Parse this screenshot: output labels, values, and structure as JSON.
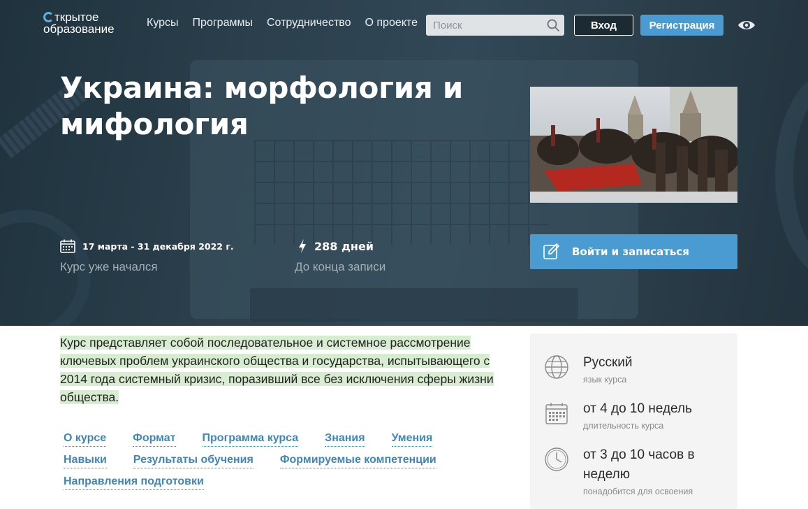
{
  "header": {
    "logo_line1": "ткрытое",
    "logo_line2": "образование",
    "nav": [
      "Курсы",
      "Программы",
      "Сотрудничество",
      "О проекте"
    ],
    "search_placeholder": "Поиск",
    "login_label": "Вход",
    "register_label": "Регистрация"
  },
  "course": {
    "title": "Украина: морфология и мифология",
    "dates": "17 марта - 31 декабря 2022 г.",
    "status": "Курс уже начался",
    "days_left": "288 дней",
    "days_left_label": "До конца записи",
    "enroll_label": "Войти и записаться",
    "description": "Курс представляет собой последовательное и системное рассмотрение ключевых проблем украинского общества и государства, испытывающего с 2014 года системный кризис, поразивший все без исключения сферы жизни общества."
  },
  "anchors": {
    "row1": [
      "О курсе",
      "Формат",
      "Программа курса",
      "Знания",
      "Умения"
    ],
    "row2": [
      "Навыки",
      "Результаты обучения",
      "Формируемые компетенции"
    ],
    "row3": [
      "Направления подготовки"
    ]
  },
  "sidebar": {
    "language": {
      "value": "Русский",
      "label": "язык курса",
      "icon": "globe-icon"
    },
    "duration": {
      "value": "от 4 до 10 недель",
      "label": "длительность курса",
      "icon": "calendar-icon"
    },
    "effort": {
      "value": "от 3 до 10 часов в неделю",
      "label": "понадобится для освоения",
      "icon": "clock-icon"
    }
  },
  "colors": {
    "accent": "#4a9bd1",
    "hero_bg": "#2b3f4c",
    "highlight": "#d7ecd0",
    "link": "#3f86b8"
  }
}
